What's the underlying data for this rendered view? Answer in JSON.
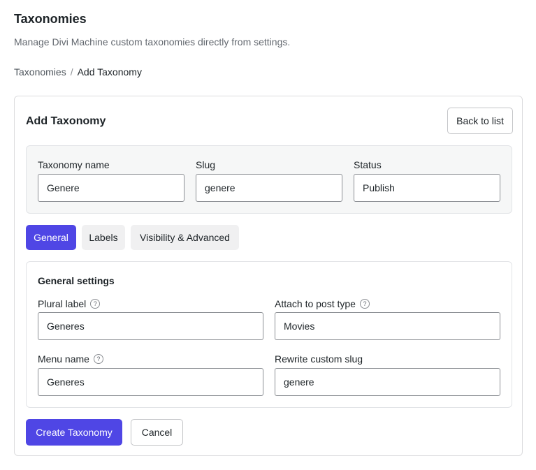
{
  "page": {
    "title": "Taxonomies",
    "subtitle": "Manage Divi Machine custom taxonomies directly from settings."
  },
  "breadcrumb": {
    "parent": "Taxonomies",
    "separator": "/",
    "current": "Add Taxonomy"
  },
  "card": {
    "title": "Add Taxonomy",
    "back_label": "Back to list"
  },
  "top_fields": {
    "name": {
      "label": "Taxonomy name",
      "value": "Genere"
    },
    "slug": {
      "label": "Slug",
      "value": "genere"
    },
    "status": {
      "label": "Status",
      "value": "Publish"
    }
  },
  "tabs": [
    {
      "label": "General",
      "active": true
    },
    {
      "label": "Labels",
      "active": false
    },
    {
      "label": "Visibility & Advanced",
      "active": false
    }
  ],
  "general": {
    "section_title": "General settings",
    "plural_label": {
      "label": "Plural label",
      "value": "Generes",
      "help": "?"
    },
    "attach_post_type": {
      "label": "Attach to post type",
      "value": "Movies",
      "help": "?"
    },
    "menu_name": {
      "label": "Menu name",
      "value": "Generes",
      "help": "?"
    },
    "rewrite_slug": {
      "label": "Rewrite custom slug",
      "value": "genere"
    }
  },
  "actions": {
    "create_label": "Create Taxonomy",
    "cancel_label": "Cancel"
  },
  "colors": {
    "accent": "#4f46e5",
    "tab_inactive_bg": "#f0f0f1",
    "panel_bg": "#f6f7f7"
  }
}
